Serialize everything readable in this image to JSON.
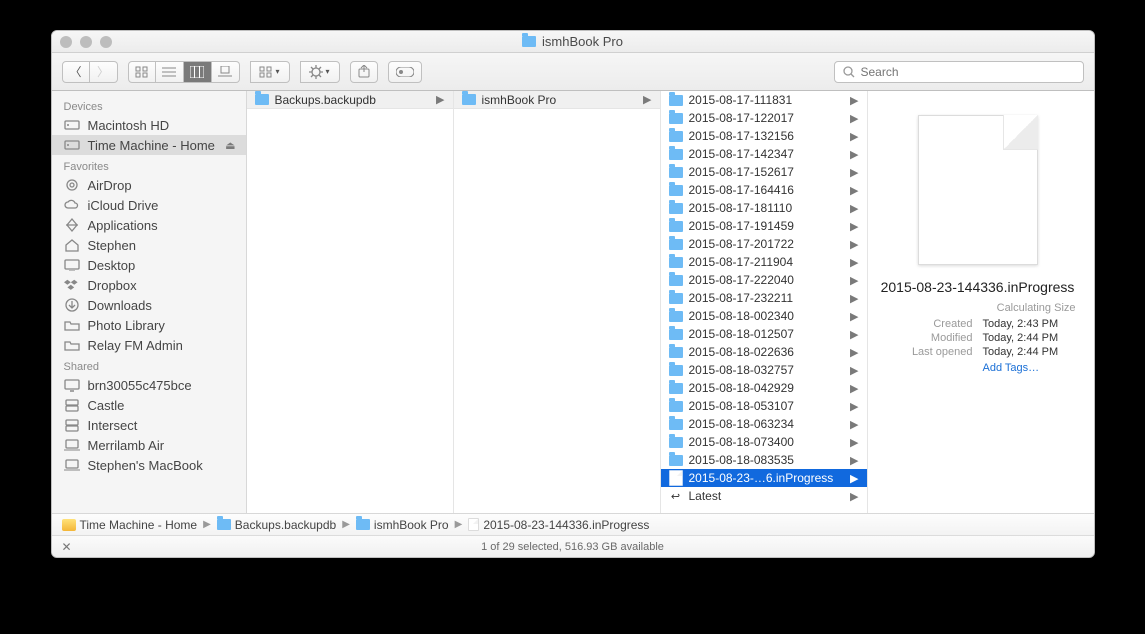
{
  "window": {
    "title": "ismhBook Pro"
  },
  "search": {
    "placeholder": "Search"
  },
  "sidebar": {
    "groups": [
      {
        "label": "Devices",
        "items": [
          {
            "label": "Macintosh HD",
            "icon": "hdd"
          },
          {
            "label": "Time Machine - Home",
            "icon": "hdd",
            "selected": true,
            "eject": true
          }
        ]
      },
      {
        "label": "Favorites",
        "items": [
          {
            "label": "AirDrop",
            "icon": "airdrop"
          },
          {
            "label": "iCloud Drive",
            "icon": "cloud"
          },
          {
            "label": "Applications",
            "icon": "apps"
          },
          {
            "label": "Stephen",
            "icon": "home"
          },
          {
            "label": "Desktop",
            "icon": "desktop"
          },
          {
            "label": "Dropbox",
            "icon": "dropbox"
          },
          {
            "label": "Downloads",
            "icon": "downloads"
          },
          {
            "label": "Photo Library",
            "icon": "folder"
          },
          {
            "label": "Relay FM Admin",
            "icon": "folder"
          }
        ]
      },
      {
        "label": "Shared",
        "items": [
          {
            "label": "brn30055c475bce",
            "icon": "display"
          },
          {
            "label": "Castle",
            "icon": "server"
          },
          {
            "label": "Intersect",
            "icon": "server"
          },
          {
            "label": "Merrilamb Air",
            "icon": "laptop"
          },
          {
            "label": "Stephen's MacBook",
            "icon": "laptop"
          }
        ]
      }
    ]
  },
  "column1": {
    "header": "Backups.backupdb"
  },
  "column2": {
    "header": "ismhBook Pro"
  },
  "column3": {
    "items": [
      "2015-08-17-111831",
      "2015-08-17-122017",
      "2015-08-17-132156",
      "2015-08-17-142347",
      "2015-08-17-152617",
      "2015-08-17-164416",
      "2015-08-17-181110",
      "2015-08-17-191459",
      "2015-08-17-201722",
      "2015-08-17-211904",
      "2015-08-17-222040",
      "2015-08-17-232211",
      "2015-08-18-002340",
      "2015-08-18-012507",
      "2015-08-18-022636",
      "2015-08-18-032757",
      "2015-08-18-042929",
      "2015-08-18-053107",
      "2015-08-18-063234",
      "2015-08-18-073400",
      "2015-08-18-083535"
    ],
    "selected": "2015-08-23-…6.inProgress",
    "latest": "Latest"
  },
  "preview": {
    "name": "2015-08-23-144336.inProgress",
    "calculating": "Calculating Size",
    "created_k": "Created",
    "created_v": "Today, 2:43 PM",
    "modified_k": "Modified",
    "modified_v": "Today, 2:44 PM",
    "opened_k": "Last opened",
    "opened_v": "Today, 2:44 PM",
    "addtags": "Add Tags…"
  },
  "pathbar": {
    "segs": [
      "Time Machine - Home",
      "Backups.backupdb",
      "ismhBook Pro",
      "2015-08-23-144336.inProgress"
    ]
  },
  "status": {
    "text": "1 of 29 selected, 516.93 GB available"
  }
}
